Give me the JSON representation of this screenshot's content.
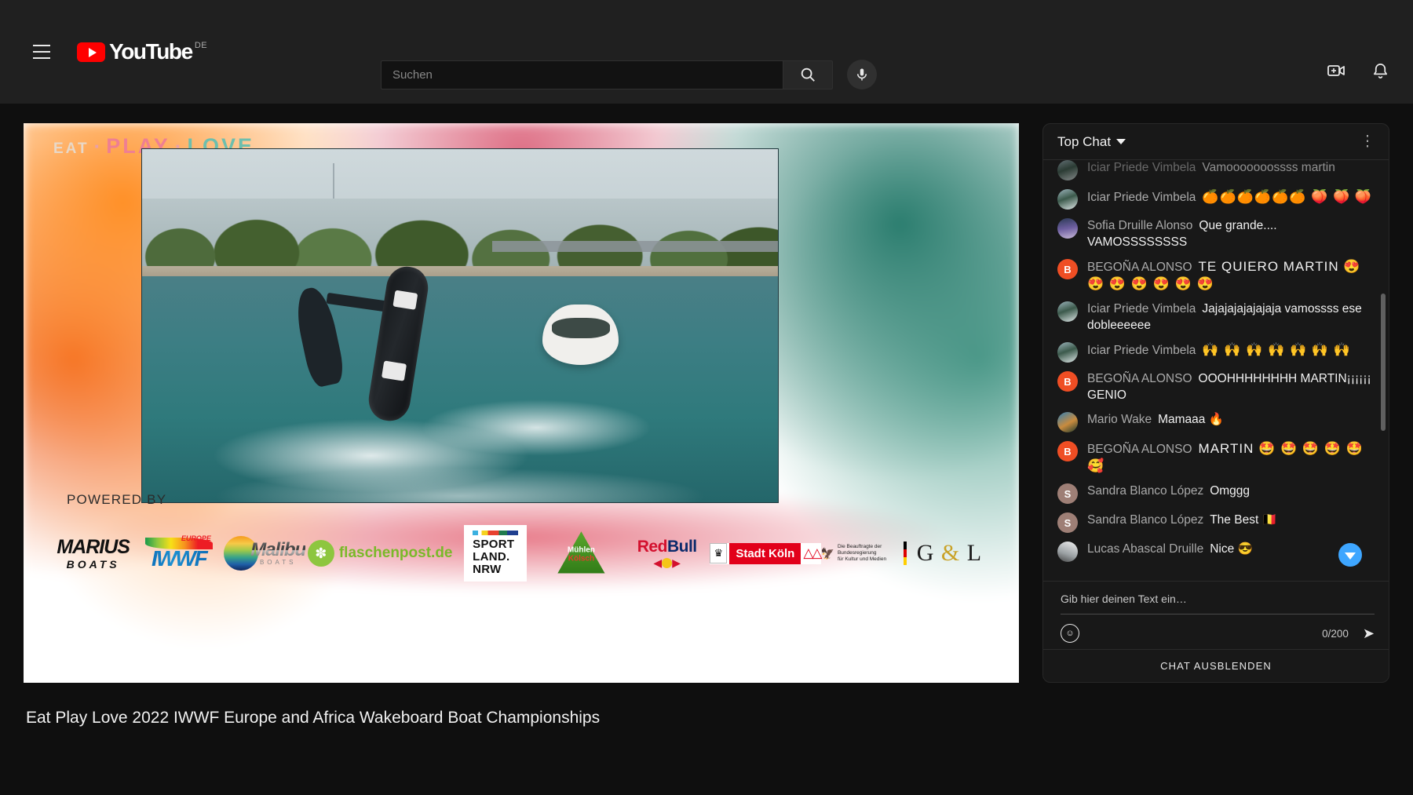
{
  "masthead": {
    "menu_icon": "hamburger-menu-icon",
    "logo_text": "YouTube",
    "country_code": "DE",
    "search": {
      "placeholder": "Suchen",
      "value": "",
      "button_icon": "search-icon"
    },
    "voice_icon": "microphone-icon",
    "create_icon": "create-video-icon",
    "notifications_icon": "bell-icon"
  },
  "player": {
    "branding": {
      "eat": "EAT",
      "dot": "·",
      "play": "PLAY",
      "love": "LOVE"
    },
    "powered_by_label": "POWERED BY",
    "sponsors": [
      {
        "name": "Marius Boats",
        "line1": "MARIUS",
        "line2": "BOATS"
      },
      {
        "name": "IWWF Europe",
        "letters": "IWWF",
        "region": "EUROPE"
      },
      {
        "name": "Malibu Boats",
        "line1": "Malibu",
        "line2": "BOATS"
      },
      {
        "name": "flaschenpost.de",
        "text": "flaschenpost.de"
      },
      {
        "name": "Sportland NRW",
        "line1": "SPORT",
        "line2": "LAND.",
        "line3": "NRW"
      },
      {
        "name": "Mühlen Kölsch",
        "line1": "Mühlen",
        "line2": "Kölsch"
      },
      {
        "name": "Red Bull",
        "line1": "Red",
        "line2": "Bull"
      },
      {
        "name": "Stadt Köln",
        "text": "Stadt Köln"
      },
      {
        "name": "Die Beauftragte der Bundesregierung für Kultur und Medien",
        "line1": "Die Beauftragte der Bundesregierung",
        "line2": "für Kultur und Medien"
      },
      {
        "name": "G & L",
        "g": "G",
        "amp": "&",
        "l": "L"
      }
    ]
  },
  "video": {
    "title": "Eat Play Love 2022 IWWF Europe and Africa Wakeboard Boat Championships"
  },
  "chat": {
    "mode_label": "Top Chat",
    "menu_icon": "kebab-menu-icon",
    "scroll_down_icon": "scroll-to-bottom-icon",
    "messages": [
      {
        "author": "Iciar Priede Vimbela",
        "text": "Vamooooooossss martin",
        "avatar": "photo-a",
        "type": "photo"
      },
      {
        "author": "Iciar Priede Vimbela",
        "text": "🍊🍊🍊🍊🍊🍊 🍑 🍑 🍑",
        "avatar": "photo-a",
        "type": "photo"
      },
      {
        "author": "Sofia Druille Alonso",
        "text": "Que grande.... VAMOSSSSSSSS",
        "avatar": "photo-b",
        "type": "photo"
      },
      {
        "author": "BEGOÑA ALONSO",
        "text": "TE QUIERO MARTIN 😍 😍 😍 😍 😍 😍 😍",
        "avatar": "B",
        "type": "letter-orange"
      },
      {
        "author": "Iciar Priede Vimbela",
        "text": "Jajajajajajajaja vamossss ese dobleeeeee",
        "avatar": "photo-a",
        "type": "photo"
      },
      {
        "author": "Iciar Priede Vimbela",
        "text": "🙌 🙌 🙌 🙌 🙌 🙌 🙌",
        "avatar": "photo-a",
        "type": "photo"
      },
      {
        "author": "BEGOÑA ALONSO",
        "text": "OOOHHHHHHHH MARTIN¡¡¡¡¡¡ GENIO",
        "avatar": "B",
        "type": "letter-orange"
      },
      {
        "author": "Mario Wake",
        "text": "Mamaaa 🔥",
        "avatar": "photo-c",
        "type": "photo"
      },
      {
        "author": "BEGOÑA ALONSO",
        "text": "MARTIN 🤩 🤩 🤩 🤩 🤩 🥰",
        "avatar": "B",
        "type": "letter-orange"
      },
      {
        "author": "Sandra Blanco López",
        "text": "Omggg",
        "avatar": "S",
        "type": "letter-brown"
      },
      {
        "author": "Sandra Blanco López",
        "text": "The Best 🇧🇪",
        "avatar": "S",
        "type": "letter-brown"
      },
      {
        "author": "Lucas Abascal Druille",
        "text": "Nice 😎",
        "avatar": "photo-d",
        "type": "photo"
      }
    ],
    "compose": {
      "placeholder": "Gib hier deinen Text ein…",
      "value": "",
      "emoji_icon": "emoji-picker-icon",
      "char_count": "0/200",
      "send_icon": "send-icon"
    },
    "hide_chat_label": "CHAT AUSBLENDEN"
  }
}
